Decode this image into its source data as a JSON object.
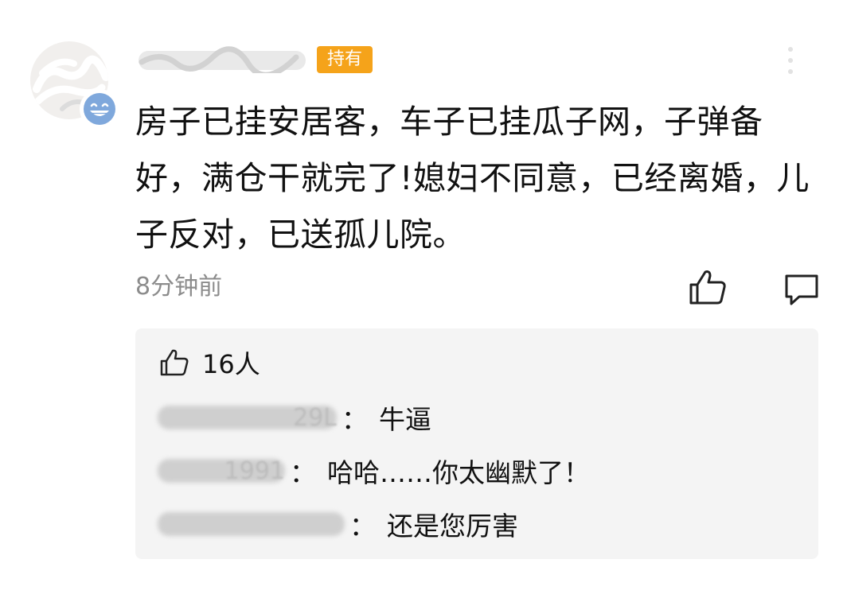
{
  "comment": {
    "badge": "持有",
    "text": "房子已挂安居客，车子已挂瓜子网，子弹备好，满仓干就完了!媳妇不同意，已经离婚，儿子反对，已送孤儿院。",
    "time": "8分钟前",
    "icons": {
      "avatar": "avatar-image",
      "emoji": "grinning-face-icon",
      "more": "more-vertical-icon",
      "like": "thumbs-up-icon",
      "reply": "comment-bubble-icon"
    },
    "badge_color": "#f5a31a"
  },
  "replies_panel": {
    "likes_count": "16人",
    "replies": [
      {
        "name_suffix": "29L",
        "separator": "：",
        "text": "牛逼"
      },
      {
        "name_suffix": "1991",
        "separator": "：",
        "text": "哈哈……你太幽默了！"
      },
      {
        "name_suffix": "",
        "separator": "：",
        "text": "还是您厉害"
      }
    ]
  }
}
